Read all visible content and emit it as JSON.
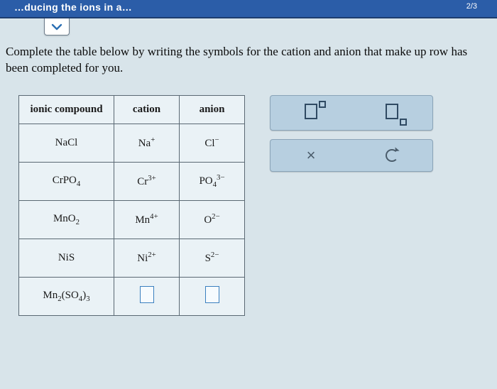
{
  "topbar": {
    "left_text": "…ducing the ions in a…",
    "right_text": "2/3"
  },
  "instruction": "Complete the table below by writing the symbols for the cation and anion that make up row has been completed for you.",
  "table": {
    "headers": {
      "compound": "ionic compound",
      "cation": "cation",
      "anion": "anion"
    },
    "rows": [
      {
        "compound_html": "NaCl",
        "cation_html": "Na<sup>+</sup>",
        "anion_html": "Cl<sup>−</sup>"
      },
      {
        "compound_html": "CrPO<sub>4</sub>",
        "cation_html": "Cr<sup>3+</sup>",
        "anion_html": "PO<sub>4</sub><sup>3−</sup>"
      },
      {
        "compound_html": "MnO<sub>2</sub>",
        "cation_html": "Mn<sup>4+</sup>",
        "anion_html": "O<sup>2−</sup>"
      },
      {
        "compound_html": "NiS",
        "cation_html": "Ni<sup>2+</sup>",
        "anion_html": "S<sup>2−</sup>"
      },
      {
        "compound_html": "Mn<sub>2</sub>(SO<sub>4</sub>)<sub>3</sub>",
        "cation_html": "",
        "anion_html": ""
      }
    ]
  },
  "tools": {
    "template_superscript_name": "superscript-template",
    "template_subscript_name": "subscript-template",
    "clear_label": "×",
    "reset_label": "↺"
  }
}
